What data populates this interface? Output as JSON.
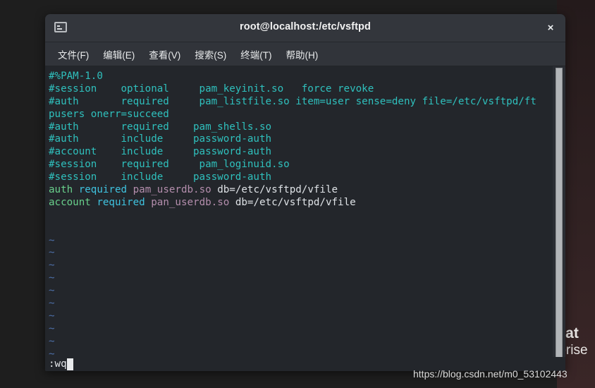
{
  "desktop": {
    "wallpaper_brand_line1": "Hat",
    "wallpaper_brand_line2": "rprise",
    "watermark": "https://blog.csdn.net/m0_53102443"
  },
  "window": {
    "title": "root@localhost:/etc/vsftpd",
    "icon": "terminal-icon",
    "close_label": "×"
  },
  "menubar": {
    "items": [
      {
        "label": "文件(F)"
      },
      {
        "label": "编辑(E)"
      },
      {
        "label": "查看(V)"
      },
      {
        "label": "搜索(S)"
      },
      {
        "label": "终端(T)"
      },
      {
        "label": "帮助(H)"
      }
    ]
  },
  "editor": {
    "lines": [
      {
        "type": "comment",
        "text": "#%PAM-1.0"
      },
      {
        "type": "comment",
        "text": "#session    optional     pam_keyinit.so   force revoke"
      },
      {
        "type": "comment",
        "text": "#auth       required     pam_listfile.so item=user sense=deny file=/etc/vsftpd/ft"
      },
      {
        "type": "comment",
        "text": "pusers onerr=succeed"
      },
      {
        "type": "comment",
        "text": "#auth       required    pam_shells.so"
      },
      {
        "type": "comment",
        "text": "#auth       include     password-auth"
      },
      {
        "type": "comment",
        "text": "#account    include     password-auth"
      },
      {
        "type": "comment",
        "text": "#session    required     pam_loginuid.so"
      },
      {
        "type": "comment",
        "text": "#session    include     password-auth"
      },
      {
        "type": "rule",
        "keyword": "auth",
        "control": "required",
        "module": "pam_userdb.so",
        "args": "db=/etc/vsftpd/vfile"
      },
      {
        "type": "rule",
        "keyword": "account",
        "control": "required",
        "module": "pan_userdb.so",
        "args": "db=/etc/vsftpd/vfile"
      },
      {
        "type": "blank",
        "text": ""
      },
      {
        "type": "blank",
        "text": ""
      },
      {
        "type": "tilde",
        "text": "~"
      },
      {
        "type": "tilde",
        "text": "~"
      },
      {
        "type": "tilde",
        "text": "~"
      },
      {
        "type": "tilde",
        "text": "~"
      },
      {
        "type": "tilde",
        "text": "~"
      },
      {
        "type": "tilde",
        "text": "~"
      },
      {
        "type": "tilde",
        "text": "~"
      },
      {
        "type": "tilde",
        "text": "~"
      },
      {
        "type": "tilde",
        "text": "~"
      },
      {
        "type": "tilde",
        "text": "~"
      },
      {
        "type": "tilde",
        "text": "~"
      }
    ],
    "status_command": ":wq",
    "colors": {
      "comment": "#2fc0bd",
      "keyword": "#69d18c",
      "control": "#3fc3e0",
      "module": "#b48ead",
      "plain": "#dfe3e7",
      "tilde": "#4d6fa8",
      "background": "#23262b"
    }
  }
}
